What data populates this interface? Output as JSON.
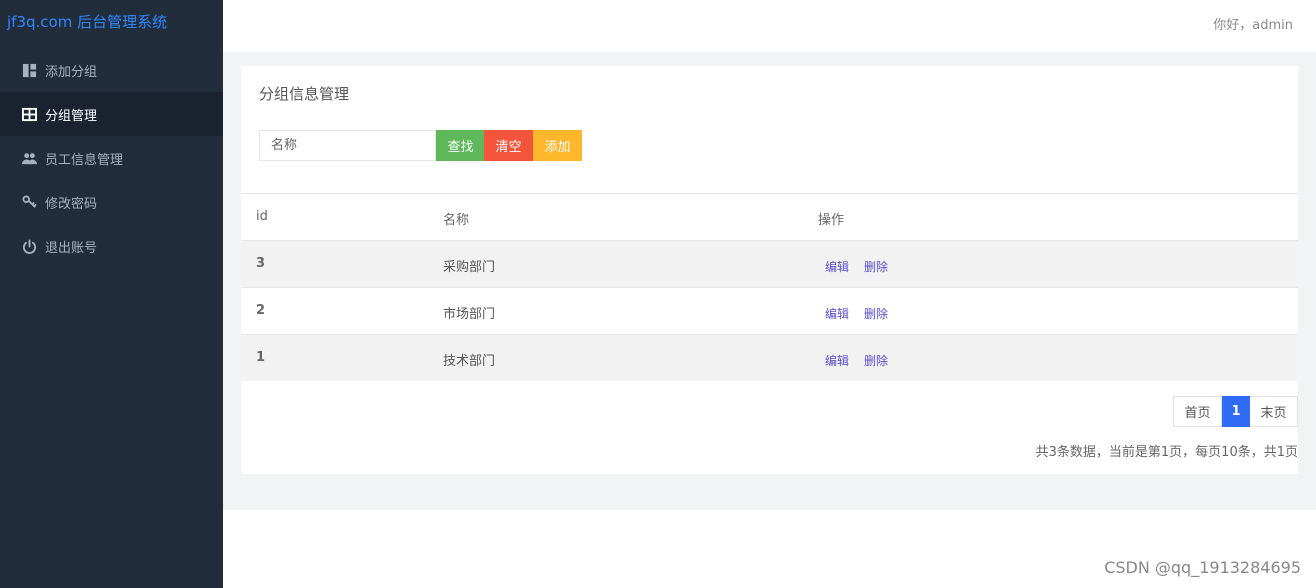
{
  "app_title": "jf3q.com 后台管理系统",
  "sidebar": {
    "items": [
      {
        "label": "添加分组",
        "icon": "dashboard-icon",
        "active": false
      },
      {
        "label": "分组管理",
        "icon": "table-icon",
        "active": true
      },
      {
        "label": "员工信息管理",
        "icon": "users-icon",
        "active": false
      },
      {
        "label": "修改密码",
        "icon": "key-icon",
        "active": false
      },
      {
        "label": "退出账号",
        "icon": "power-icon",
        "active": false
      }
    ]
  },
  "header": {
    "greeting": "你好，admin"
  },
  "panel": {
    "title": "分组信息管理",
    "search": {
      "placeholder": "名称"
    },
    "buttons": {
      "search": "查找",
      "clear": "清空",
      "add": "添加"
    }
  },
  "table": {
    "headers": [
      "id",
      "名称",
      "操作"
    ],
    "rows": [
      {
        "id": "3",
        "name": "采购部门"
      },
      {
        "id": "2",
        "name": "市场部门"
      },
      {
        "id": "1",
        "name": "技术部门"
      }
    ],
    "actions": {
      "edit": "编辑",
      "delete": "删除"
    }
  },
  "pagination": {
    "first": "首页",
    "current": "1",
    "last": "末页",
    "info": "共3条数据，当前是第1页，每页10条，共1页"
  },
  "watermark": "CSDN @qq_1913284695",
  "colors": {
    "sidebar_bg": "#222d3c",
    "brand": "#2f88ff",
    "search_button": "#5fb85a",
    "clear_button": "#f2553c",
    "add_button": "#ffb72b",
    "page_current": "#2f6bf5",
    "action_link": "#5b4fd0"
  }
}
